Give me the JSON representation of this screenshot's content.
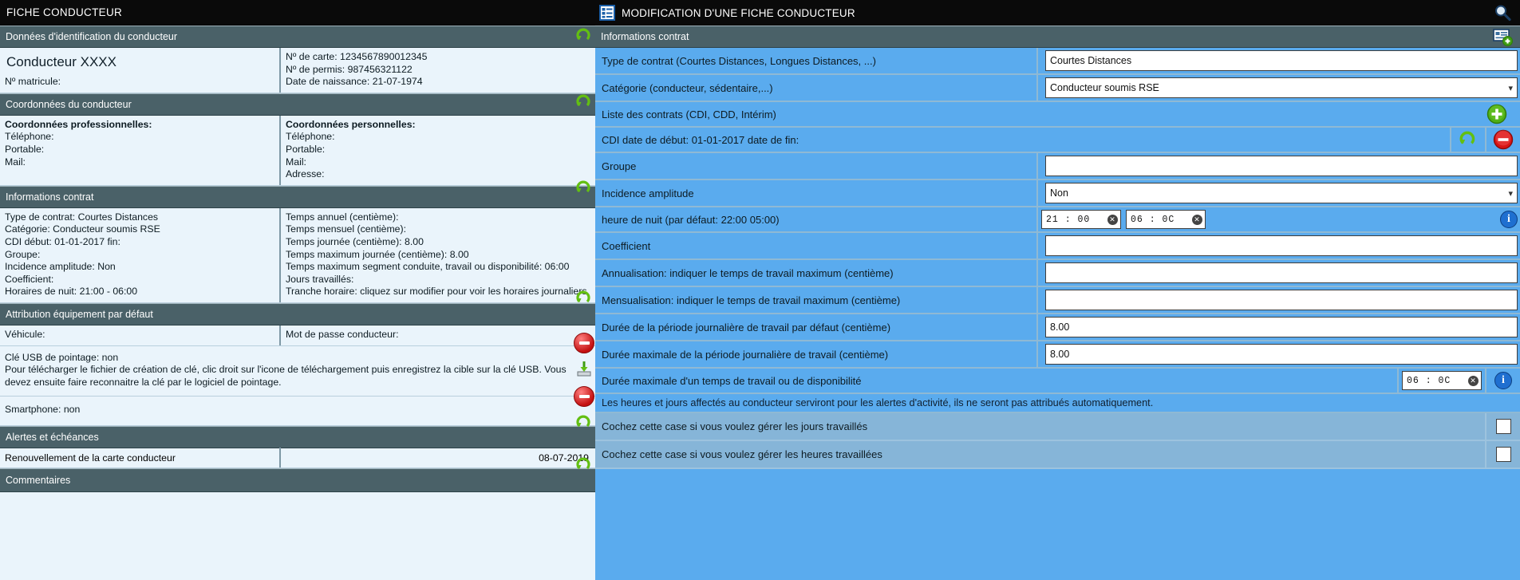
{
  "left": {
    "titlebar": "FICHE CONDUCTEUR",
    "sections": {
      "identification": "Données d'identification du conducteur",
      "coordonnees": "Coordonnées du conducteur",
      "contrat": "Informations contrat",
      "equipement": "Attribution équipement par défaut",
      "alertes": "Alertes et échéances",
      "commentaires": "Commentaires"
    },
    "identification": {
      "driver_name": "Conducteur XXXX",
      "matricule_label": "Nº matricule:",
      "carte": "Nº de carte: 1234567890012345",
      "permis": "Nº de permis: 987456321122",
      "naissance": "Date de naissance: 21-07-1974"
    },
    "coordonnees": {
      "pro_title": "Coordonnées professionnelles:",
      "pro_lines": [
        "Téléphone:",
        "Portable:",
        "Mail:"
      ],
      "perso_title": "Coordonnées personnelles:",
      "perso_lines": [
        "Téléphone:",
        "Portable:",
        "Mail:",
        "Adresse:"
      ]
    },
    "contrat_left": [
      "Type de contrat: Courtes Distances",
      "Catégorie: Conducteur soumis RSE",
      "CDI début: 01-01-2017 fin:",
      "Groupe:",
      "Incidence amplitude: Non",
      "Coefficient:",
      "Horaires de nuit: 21:00 - 06:00"
    ],
    "contrat_right": [
      "Temps annuel (centième):",
      "Temps mensuel (centième):",
      "Temps journée (centième): 8.00",
      "Temps maximum journée (centième): 8.00",
      "Temps maximum segment conduite, travail ou disponibilité: 06:00",
      "Jours travaillés:",
      "Tranche horaire: cliquez sur modifier pour voir les horaires journaliers"
    ],
    "equipement": {
      "vehicule": "Véhicule:",
      "motdepasse": "Mot de passe conducteur:",
      "usb_title": "Clé USB de pointage: non",
      "usb_text": "Pour télécharger le fichier de création de clé, clic droit sur l'icone de téléchargement puis enregistrez la cible sur la clé USB. Vous devez ensuite faire reconnaitre la clé par le logiciel de pointage.",
      "smartphone": "Smartphone: non"
    },
    "alertes": {
      "renouvellement_label": "Renouvellement de la carte conducteur",
      "renouvellement_date": "08-07-2019"
    }
  },
  "right": {
    "titlebar": "MODIFICATION D'UNE FICHE CONDUCTEUR",
    "title_icon": "list-document-icon",
    "search_icon": "magnifier-icon",
    "section_contrat": "Informations contrat",
    "section_contrat_icon": "add-record-icon",
    "rows": [
      {
        "label": "Type de contrat (Courtes Distances, Longues Distances, ...)",
        "type": "text",
        "value": "Courtes Distances"
      },
      {
        "label": "Catégorie (conducteur, sédentaire,...)",
        "type": "select",
        "value": "Conducteur soumis RSE"
      },
      {
        "label": "Liste des contrats (CDI, CDD, Intérim)",
        "type": "action",
        "action": "add"
      },
      {
        "label": "CDI date de début: 01-01-2017 date de fin:",
        "type": "action2",
        "action": "refresh-remove"
      },
      {
        "label": "Groupe",
        "type": "text",
        "value": ""
      },
      {
        "label": "Incidence amplitude",
        "type": "select",
        "value": "Non"
      },
      {
        "label": "heure de nuit (par défaut: 22:00 05:00)",
        "type": "time2",
        "value1": "21 : 00",
        "value2": "06 : 0C"
      },
      {
        "label": "Coefficient",
        "type": "text",
        "value": ""
      },
      {
        "label": "Annualisation: indiquer le temps de travail maximum (centième)",
        "type": "text",
        "value": ""
      },
      {
        "label": "Mensualisation: indiquer le temps de travail maximum (centième)",
        "type": "text",
        "value": ""
      },
      {
        "label": "Durée de la période journalière de travail par défaut (centième)",
        "type": "text",
        "value": "8.00"
      },
      {
        "label": "Durée maximale de la période journalière de travail (centième)",
        "type": "text",
        "value": "8.00"
      },
      {
        "label": "Durée maximale d'un temps de travail ou de disponibilité",
        "type": "time1",
        "value1": "06 : 0C"
      }
    ],
    "note": "Les heures et jours affectés au conducteur serviront pour les alertes d'activité, ils ne seront pas attribués automatiquement.",
    "checkboxes": [
      {
        "label": "Cochez cette case si vous voulez gérer les jours travaillés",
        "checked": false
      },
      {
        "label": "Cochez cette case si vous voulez gérer les heures travaillées",
        "checked": false
      }
    ]
  },
  "icons": {
    "refresh": "refresh-icon",
    "add_plus": "add-plus-icon",
    "remove_minus": "remove-minus-icon",
    "download": "download-icon",
    "info": "info-icon",
    "clear": "clear-x-icon"
  },
  "colors": {
    "accent_blue": "#5aabee",
    "header_slate": "#4a6168",
    "panel_light": "#eaf4fb",
    "green": "#3f9c12",
    "red": "#c41010",
    "info_blue": "#1f6fd0"
  }
}
